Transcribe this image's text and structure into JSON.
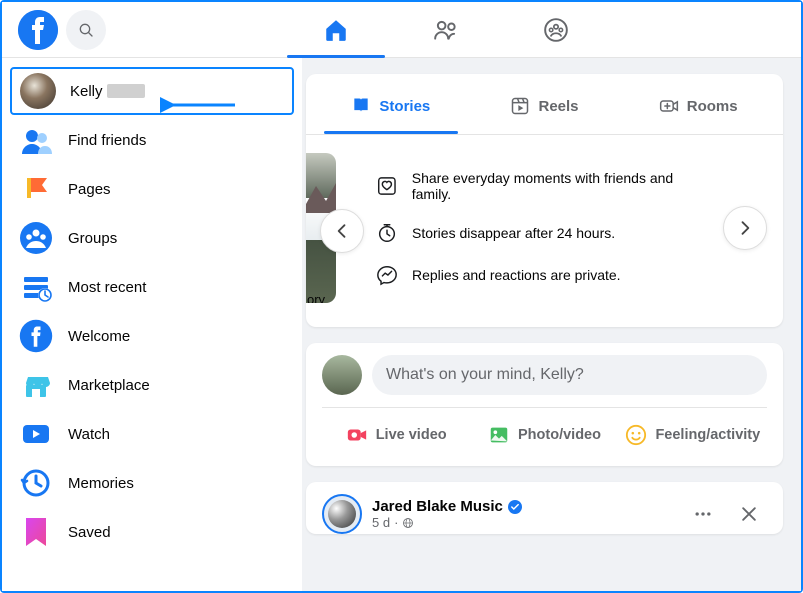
{
  "header": {
    "nav": {
      "home": "home",
      "friends": "friends",
      "groups": "groups"
    }
  },
  "sidebar": {
    "profile_name": "Kelly",
    "items": [
      {
        "label": "Find friends"
      },
      {
        "label": "Pages"
      },
      {
        "label": "Groups"
      },
      {
        "label": "Most recent"
      },
      {
        "label": "Welcome"
      },
      {
        "label": "Marketplace"
      },
      {
        "label": "Watch"
      },
      {
        "label": "Memories"
      },
      {
        "label": "Saved"
      }
    ]
  },
  "stories": {
    "tabs": {
      "stories": "Stories",
      "reels": "Reels",
      "rooms": "Rooms"
    },
    "thumb_caption": "ory",
    "bullets": [
      "Share everyday moments with friends and family.",
      "Stories disappear after 24 hours.",
      "Replies and reactions are private."
    ]
  },
  "composer": {
    "placeholder": "What's on your mind, Kelly?",
    "live": "Live video",
    "photo": "Photo/video",
    "feeling": "Feeling/activity"
  },
  "post": {
    "author": "Jared Blake Music",
    "time": "5 d",
    "sep": "·",
    "privacy": "public"
  }
}
